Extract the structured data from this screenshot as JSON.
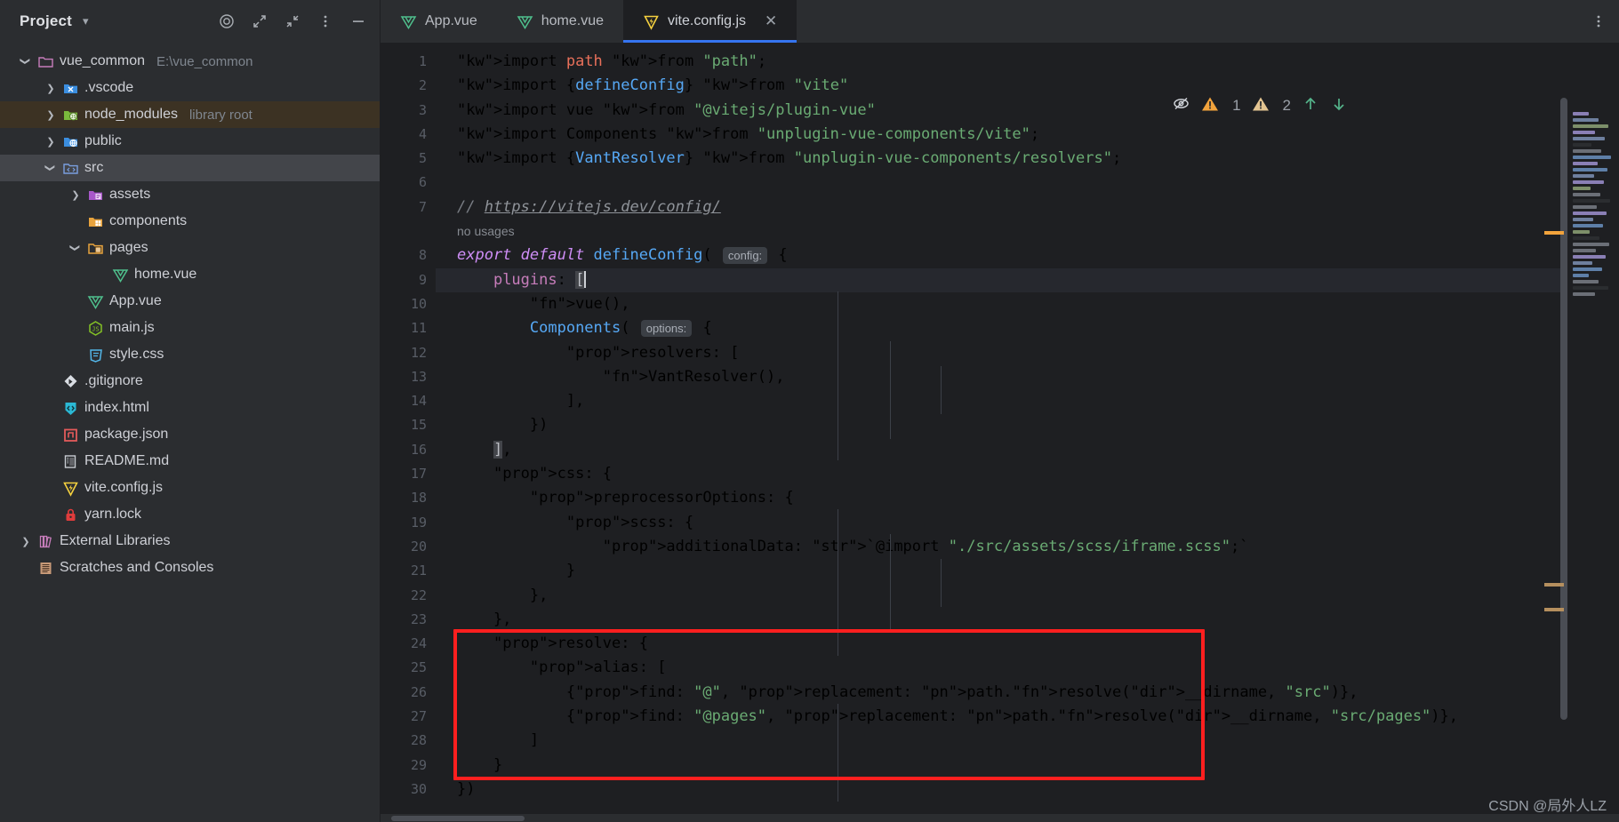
{
  "sidebar": {
    "title": "Project",
    "actions": [
      "target-icon",
      "expand-icon",
      "collapse-icon",
      "more-vertical-icon",
      "minimize-icon"
    ],
    "tree": [
      {
        "label": "vue_common",
        "sub": "E:\\vue_common",
        "icon": "folder-project-icon",
        "indent": 0,
        "arrow": "down",
        "state": "normal"
      },
      {
        "label": ".vscode",
        "sub": "",
        "icon": "folder-vscode-icon",
        "indent": 1,
        "arrow": "right",
        "state": "normal"
      },
      {
        "label": "node_modules",
        "sub": "library root",
        "icon": "folder-node-icon",
        "indent": 1,
        "arrow": "right",
        "state": "library"
      },
      {
        "label": "public",
        "sub": "",
        "icon": "folder-public-icon",
        "indent": 1,
        "arrow": "right",
        "state": "normal"
      },
      {
        "label": "src",
        "sub": "",
        "icon": "folder-src-icon",
        "indent": 1,
        "arrow": "down",
        "state": "selected"
      },
      {
        "label": "assets",
        "sub": "",
        "icon": "folder-assets-icon",
        "indent": 2,
        "arrow": "right",
        "state": "normal"
      },
      {
        "label": "components",
        "sub": "",
        "icon": "folder-components-icon",
        "indent": 2,
        "arrow": "none",
        "state": "normal"
      },
      {
        "label": "pages",
        "sub": "",
        "icon": "folder-pages-icon",
        "indent": 2,
        "arrow": "down",
        "state": "normal"
      },
      {
        "label": "home.vue",
        "sub": "",
        "icon": "vue-file-icon",
        "indent": 3,
        "arrow": "none",
        "state": "normal"
      },
      {
        "label": "App.vue",
        "sub": "",
        "icon": "vue-file-icon",
        "indent": 2,
        "arrow": "none",
        "state": "normal"
      },
      {
        "label": "main.js",
        "sub": "",
        "icon": "js-node-icon",
        "indent": 2,
        "arrow": "none",
        "state": "normal"
      },
      {
        "label": "style.css",
        "sub": "",
        "icon": "css-file-icon",
        "indent": 2,
        "arrow": "none",
        "state": "normal"
      },
      {
        "label": ".gitignore",
        "sub": "",
        "icon": "git-icon",
        "indent": 1,
        "arrow": "none",
        "state": "normal"
      },
      {
        "label": "index.html",
        "sub": "",
        "icon": "html-file-icon",
        "indent": 1,
        "arrow": "none",
        "state": "normal"
      },
      {
        "label": "package.json",
        "sub": "",
        "icon": "npm-icon",
        "indent": 1,
        "arrow": "none",
        "state": "normal"
      },
      {
        "label": "README.md",
        "sub": "",
        "icon": "markdown-icon",
        "indent": 1,
        "arrow": "none",
        "state": "normal"
      },
      {
        "label": "vite.config.js",
        "sub": "",
        "icon": "vite-icon",
        "indent": 1,
        "arrow": "none",
        "state": "normal"
      },
      {
        "label": "yarn.lock",
        "sub": "",
        "icon": "lock-icon",
        "indent": 1,
        "arrow": "none",
        "state": "normal"
      },
      {
        "label": "External Libraries",
        "sub": "",
        "icon": "libraries-icon",
        "indent": 0,
        "arrow": "right",
        "state": "normal"
      },
      {
        "label": "Scratches and Consoles",
        "sub": "",
        "icon": "scratches-icon",
        "indent": 0,
        "arrow": "none",
        "state": "normal"
      }
    ]
  },
  "tabs": [
    {
      "label": "App.vue",
      "icon": "vue-file-icon",
      "active": false,
      "closable": false
    },
    {
      "label": "home.vue",
      "icon": "vue-file-icon",
      "active": false,
      "closable": false
    },
    {
      "label": "vite.config.js",
      "icon": "vite-icon",
      "active": true,
      "closable": true
    }
  ],
  "inspections": {
    "eye_icon": "inspection-eye-off-icon",
    "warning_icon": "warning-triangle-icon",
    "warning_count": "1",
    "weak_warning_icon": "weak-warning-triangle-icon",
    "weak_warning_count": "2",
    "prev_icon": "arrow-up-icon",
    "next_icon": "arrow-down-icon"
  },
  "editor": {
    "filename": "vite.config.js",
    "inlay_no_usages": "no usages",
    "inlay_config": "config:",
    "inlay_options": "options:",
    "lines": [
      {
        "n": "1",
        "text": "import path from \"path\";"
      },
      {
        "n": "2",
        "text": "import {defineConfig} from \"vite\""
      },
      {
        "n": "3",
        "text": "import vue from \"@vitejs/plugin-vue\""
      },
      {
        "n": "4",
        "text": "import Components from \"unplugin-vue-components/vite\";"
      },
      {
        "n": "5",
        "text": "import {VantResolver} from \"unplugin-vue-components/resolvers\";"
      },
      {
        "n": "6",
        "text": ""
      },
      {
        "n": "7",
        "text": "// https://vitejs.dev/config/"
      },
      {
        "n": "8",
        "text": "export default defineConfig( config: {"
      },
      {
        "n": "9",
        "text": "    plugins: ["
      },
      {
        "n": "10",
        "text": "        vue(),"
      },
      {
        "n": "11",
        "text": "        Components( options: {"
      },
      {
        "n": "12",
        "text": "            resolvers: ["
      },
      {
        "n": "13",
        "text": "                VantResolver(),"
      },
      {
        "n": "14",
        "text": "            ],"
      },
      {
        "n": "15",
        "text": "        })"
      },
      {
        "n": "16",
        "text": "    ],"
      },
      {
        "n": "17",
        "text": "    css: {"
      },
      {
        "n": "18",
        "text": "        preprocessorOptions: {"
      },
      {
        "n": "19",
        "text": "            scss: {"
      },
      {
        "n": "20",
        "text": "                additionalData: `@import \"./src/assets/scss/iframe.scss\";`"
      },
      {
        "n": "21",
        "text": "            }"
      },
      {
        "n": "22",
        "text": "        },"
      },
      {
        "n": "23",
        "text": "    },"
      },
      {
        "n": "24",
        "text": "    resolve: {"
      },
      {
        "n": "25",
        "text": "        alias: ["
      },
      {
        "n": "26",
        "text": "            {find: \"@\", replacement: path.resolve(__dirname, \"src\")},"
      },
      {
        "n": "27",
        "text": "            {find: \"@pages\", replacement: path.resolve(__dirname, \"src/pages\")},"
      },
      {
        "n": "28",
        "text": "        ]"
      },
      {
        "n": "29",
        "text": "    }"
      },
      {
        "n": "30",
        "text": "})"
      }
    ]
  },
  "annotation": {
    "type": "red-rectangle",
    "covers_lines": "24-29"
  },
  "watermark": "CSDN @局外人LZ",
  "colors": {
    "accent": "#3574f0",
    "annotation": "#ff1f1f",
    "background": "#1e1f22",
    "sidebar_bg": "#2b2d30",
    "selected_row": "#43454a",
    "library_row": "#3c3223",
    "string": "#6aab73",
    "keyword": "#cf8ef7",
    "property": "#c77dbb",
    "function": "#56a8f5"
  }
}
